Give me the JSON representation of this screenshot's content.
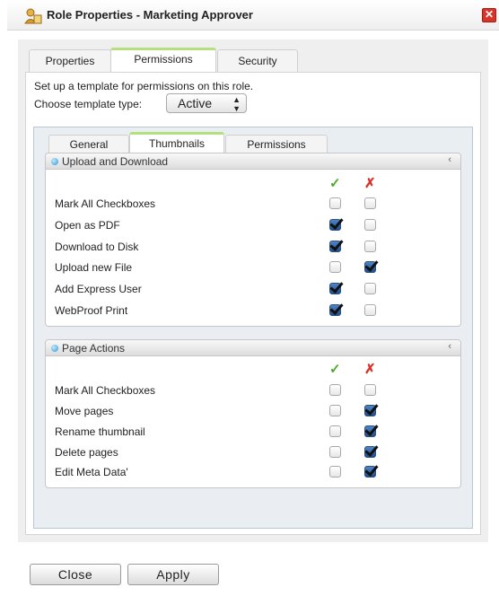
{
  "window": {
    "title": "Role Properties - Marketing Approver",
    "close_glyph": "✕"
  },
  "tabs": [
    {
      "label": "Properties",
      "active": false
    },
    {
      "label": "Permissions",
      "active": true
    },
    {
      "label": "Security",
      "active": false
    }
  ],
  "description": "Set up a template for permissions on this role.",
  "template": {
    "label": "Choose template type:",
    "value": "Active",
    "arrows": "▲\n▼"
  },
  "subtabs": [
    {
      "label": "General",
      "active": false
    },
    {
      "label": "Thumbnails",
      "active": true
    },
    {
      "label": "Permissions",
      "active": false
    }
  ],
  "column_headers": {
    "allow": "✓",
    "deny": "✗"
  },
  "sections": [
    {
      "title": "Upload and Download",
      "collapse_glyph": "‹",
      "rows": [
        {
          "label": "Mark All Checkboxes",
          "allow": false,
          "deny": false
        },
        {
          "label": "Open as PDF",
          "allow": true,
          "deny": false
        },
        {
          "label": "Download to Disk",
          "allow": true,
          "deny": false
        },
        {
          "label": "Upload new File",
          "allow": false,
          "deny": true
        },
        {
          "label": "Add Express User",
          "allow": true,
          "deny": false
        },
        {
          "label": "WebProof Print",
          "allow": true,
          "deny": false
        }
      ]
    },
    {
      "title": "Page Actions",
      "collapse_glyph": "‹",
      "rows": [
        {
          "label": "Mark All Checkboxes",
          "allow": false,
          "deny": false
        },
        {
          "label": "Move pages",
          "allow": false,
          "deny": true
        },
        {
          "label": "Rename thumbnail",
          "allow": false,
          "deny": true
        },
        {
          "label": "Delete pages",
          "allow": false,
          "deny": true
        },
        {
          "label": "Edit Meta Data'",
          "allow": false,
          "deny": true
        }
      ]
    }
  ],
  "buttons": {
    "close": "Close",
    "apply": "Apply"
  },
  "colors": {
    "allow": "#4caa2b",
    "deny": "#d8352a",
    "active_tab_accent": "#b5e07e"
  }
}
